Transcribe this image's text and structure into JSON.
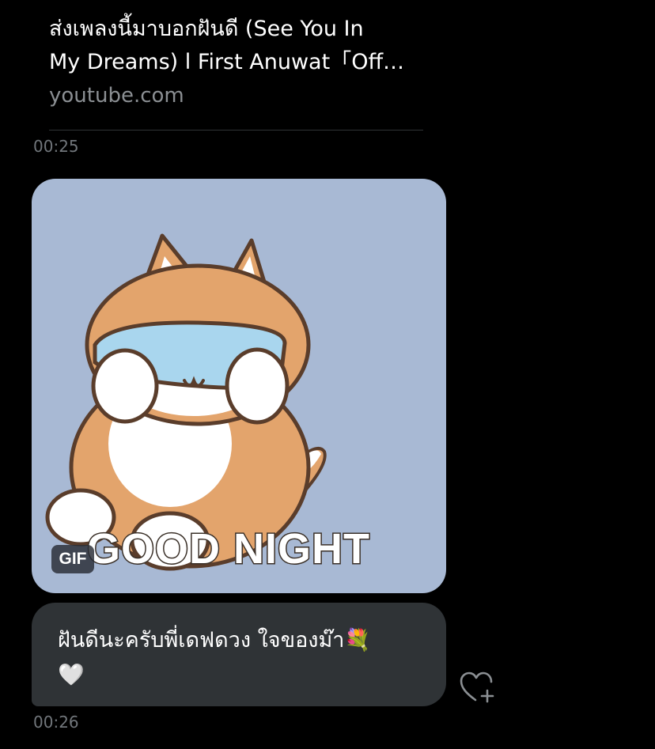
{
  "link_card": {
    "title": "ส่งเพลงนี้มาบอกฝันดี (See You In\nMy Dreams) l First Anuwat「Off…",
    "domain": "youtube.com"
  },
  "messages": [
    {
      "timestamp": "00:25"
    },
    {
      "gif_badge": "GIF",
      "gif_caption": "GOOD NIGHT",
      "text": "ฝันดีนะครับพี่เดฟดวง ใจของม๊า💐\n🤍",
      "timestamp": "00:26"
    }
  ],
  "colors": {
    "background": "#000000",
    "bubble": "#2f3336",
    "muted_text": "#71767b",
    "gif_bg": "#a8b9d4"
  },
  "icons": {
    "react": "heart-plus-icon"
  }
}
